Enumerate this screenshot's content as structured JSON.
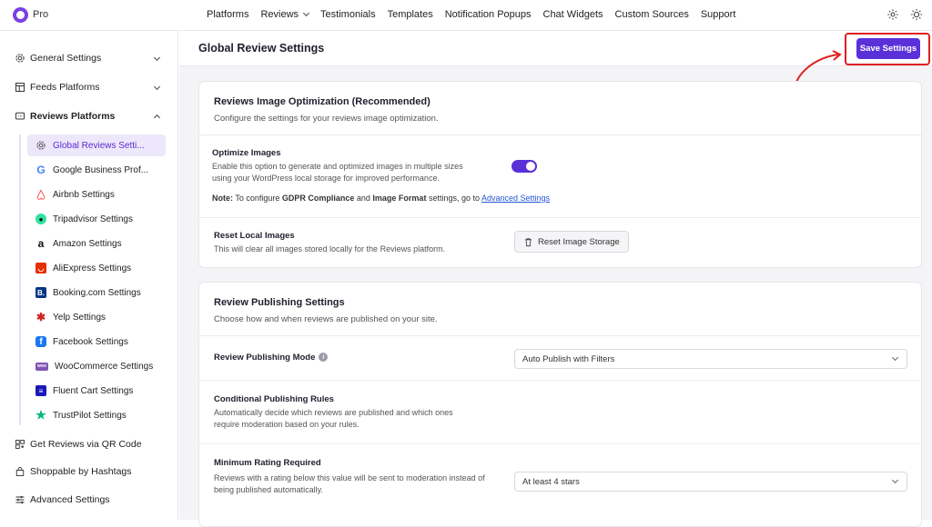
{
  "app": {
    "title": "Pro"
  },
  "nav": {
    "items": [
      "Platforms",
      "Reviews",
      "Testimonials",
      "Templates",
      "Notification Popups",
      "Chat Widgets",
      "Custom Sources",
      "Support"
    ]
  },
  "sidebar": {
    "general": "General Settings",
    "feeds": "Feeds Platforms",
    "reviews": "Reviews Platforms",
    "sub_items": [
      {
        "label": "Global Reviews Setti...",
        "icon": "gear-icon"
      },
      {
        "label": "Google Business Prof...",
        "icon": "google-icon"
      },
      {
        "label": "Airbnb Settings",
        "icon": "airbnb-icon"
      },
      {
        "label": "Tripadvisor Settings",
        "icon": "tripadvisor-icon"
      },
      {
        "label": "Amazon Settings",
        "icon": "amazon-icon"
      },
      {
        "label": "AliExpress Settings",
        "icon": "aliexpress-icon"
      },
      {
        "label": "Booking.com Settings",
        "icon": "booking-icon"
      },
      {
        "label": "Yelp Settings",
        "icon": "yelp-icon"
      },
      {
        "label": "Facebook Settings",
        "icon": "facebook-icon"
      },
      {
        "label": "WooCommerce Settings",
        "icon": "woocommerce-icon"
      },
      {
        "label": "Fluent Cart Settings",
        "icon": "fluentcart-icon"
      },
      {
        "label": "TrustPilot Settings",
        "icon": "trustpilot-icon"
      }
    ],
    "qr": "Get Reviews via QR Code",
    "shoppable": "Shoppable by Hashtags",
    "advanced": "Advanced Settings"
  },
  "main": {
    "title": "Global Review Settings",
    "save_label": "Save Settings",
    "card1": {
      "title": "Reviews Image Optimization (Recommended)",
      "subtitle": "Configure the settings for your reviews image optimization.",
      "optimize_label": "Optimize Images",
      "optimize_desc1": "Enable this option to generate and optimized images in multiple sizes",
      "optimize_desc2": "using your WordPress local storage for improved performance.",
      "note_prefix": "Note:",
      "note_text1": " To configure ",
      "note_gdpr": "GDPR Compliance",
      "note_and": " and ",
      "note_format": "Image Format",
      "note_text2": " settings, go to ",
      "note_link": "Advanced Settings",
      "reset_label": "Reset Local Images",
      "reset_desc": "This will clear all images stored locally for the Reviews platform.",
      "reset_button": "Reset Image Storage"
    },
    "card2": {
      "title": "Review Publishing Settings",
      "subtitle": "Choose how and when reviews are published on your site.",
      "mode_label": "Review Publishing Mode",
      "mode_value": "Auto Publish with Filters",
      "cond_label": "Conditional Publishing Rules",
      "cond_desc1": "Automatically decide which reviews are published and which ones",
      "cond_desc2": "require moderation based on your rules.",
      "min_label": "Minimum Rating Required",
      "min_desc1": "Reviews with a rating below this value will be sent to moderation instead of",
      "min_desc2": "being published automatically.",
      "min_value": "At least 4 stars"
    }
  },
  "colors": {
    "accent": "#5a31d9",
    "highlight": "#e02020"
  }
}
